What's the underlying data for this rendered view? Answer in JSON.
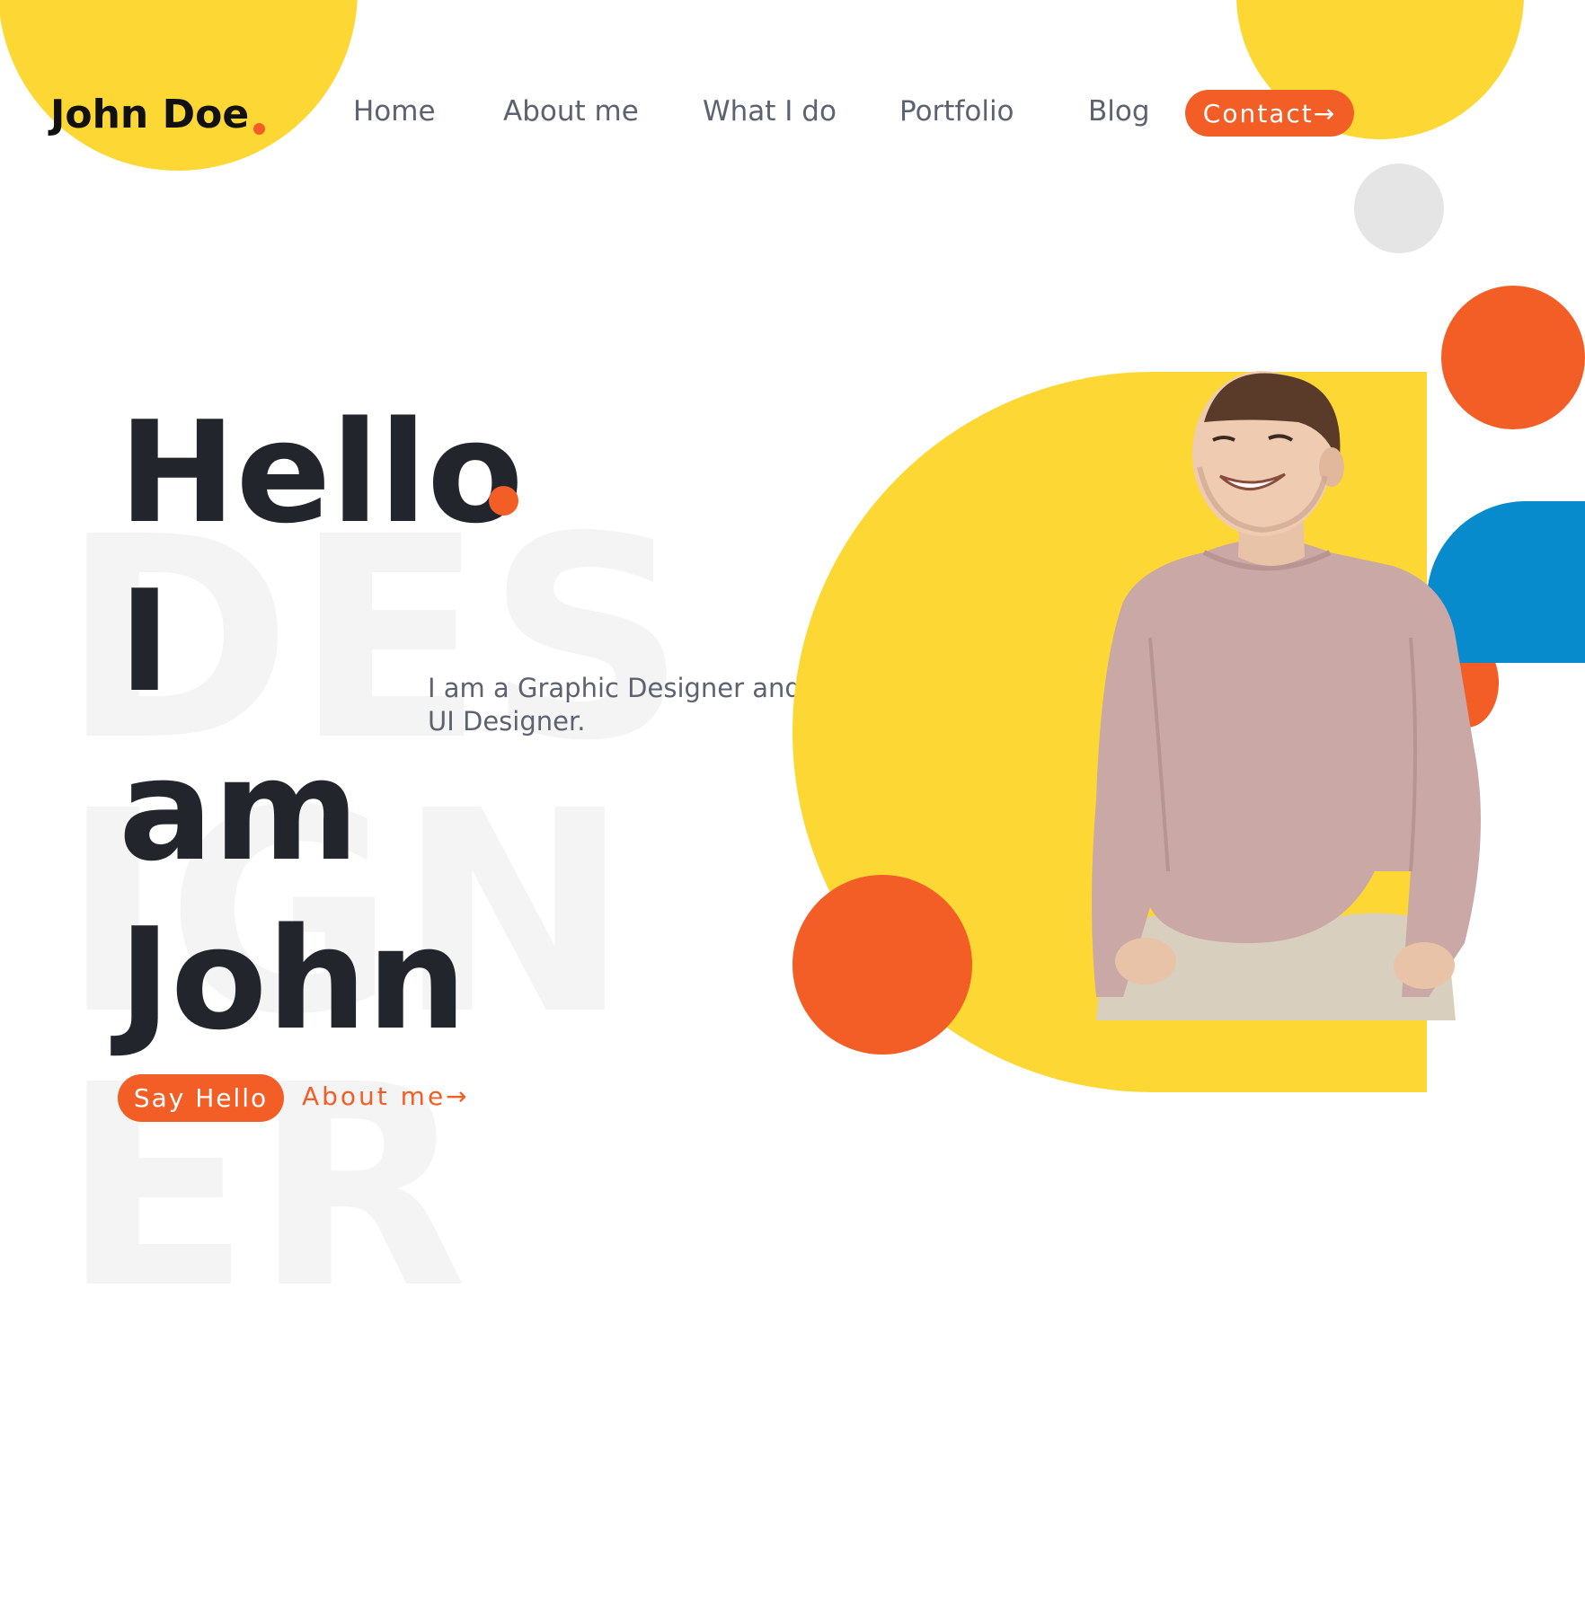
{
  "brand": {
    "name": "John Doe",
    "colors": {
      "accent": "#f25e26",
      "yellow": "#fdd835",
      "blue": "#078bcc",
      "text": "#22252b",
      "muted": "#5d6270"
    }
  },
  "nav": {
    "items": [
      {
        "label": "Home"
      },
      {
        "label": "About me"
      },
      {
        "label": "What I do"
      },
      {
        "label": "Portfolio"
      },
      {
        "label": "Blog"
      }
    ],
    "contact_label": "Contact→"
  },
  "hero": {
    "heading_lines": [
      "Hello",
      "I",
      "am",
      "John"
    ],
    "background_word": "DESIGNER",
    "tagline": "I am a Graphic Designer and UI Designer.",
    "primary_cta": "Say Hello",
    "secondary_cta": "About me→"
  },
  "portrait": {
    "icon": "person-portrait"
  }
}
